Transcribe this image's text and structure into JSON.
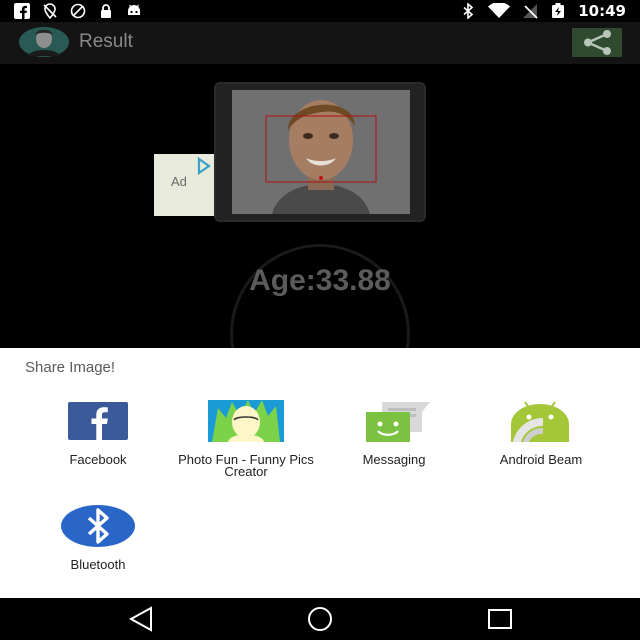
{
  "status_bar": {
    "time": "10:49",
    "left_icons": [
      "facebook-icon",
      "location-off-icon",
      "no-sim-icon",
      "lock-icon",
      "android-icon"
    ],
    "right_icons": [
      "bluetooth-icon",
      "wifi-icon",
      "no-signal-icon",
      "battery-charging-icon"
    ]
  },
  "toolbar": {
    "title": "Result",
    "share_icon": "share-icon"
  },
  "result": {
    "ad_label": "Ad",
    "age_text": "Age:33.88"
  },
  "share_sheet": {
    "title": "Share Image!",
    "apps": [
      {
        "label": "Facebook",
        "icon": "facebook-icon"
      },
      {
        "label": "Photo Fun - Funny Pics Creator",
        "icon": "photo-fun-icon"
      },
      {
        "label": "Messaging",
        "icon": "messaging-icon"
      },
      {
        "label": "Android Beam",
        "icon": "android-beam-icon"
      },
      {
        "label": "Bluetooth",
        "icon": "bluetooth-icon"
      }
    ]
  },
  "nav_bar": {
    "buttons": [
      "back-icon",
      "home-icon",
      "recents-icon"
    ]
  },
  "colors": {
    "sheet_background": "#ffffff",
    "dim_background": "#000000",
    "facebook_blue": "#3b5998",
    "android_green": "#a4c639",
    "bluetooth_blue": "#2a66c8"
  }
}
